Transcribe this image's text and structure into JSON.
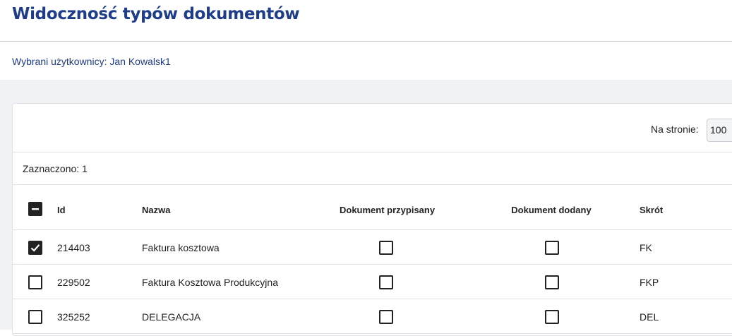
{
  "header": {
    "title": "Widoczność typów dokumentów"
  },
  "subheader": {
    "selected_users": "Wybrani użytkownicy: Jan Kowalsk1"
  },
  "toolbar": {
    "per_page_label": "Na stronie:",
    "per_page_value": "100"
  },
  "selection": {
    "count_text": "Zaznaczono: 1"
  },
  "table": {
    "columns": {
      "id": "Id",
      "name": "Nazwa",
      "assigned": "Dokument przypisany",
      "added": "Dokument dodany",
      "short": "Skrót"
    },
    "rows": [
      {
        "id": "214403",
        "name": "Faktura kosztowa",
        "short": "FK",
        "selected": true,
        "assigned": false,
        "added": false
      },
      {
        "id": "229502",
        "name": "Faktura Kosztowa Produkcyjna",
        "short": "FKP",
        "selected": false,
        "assigned": false,
        "added": false
      },
      {
        "id": "325252",
        "name": "DELEGACJA",
        "short": "DEL",
        "selected": false,
        "assigned": false,
        "added": false
      }
    ]
  },
  "icons": {
    "select_all": "minus-icon",
    "row_checked": "check-icon"
  }
}
